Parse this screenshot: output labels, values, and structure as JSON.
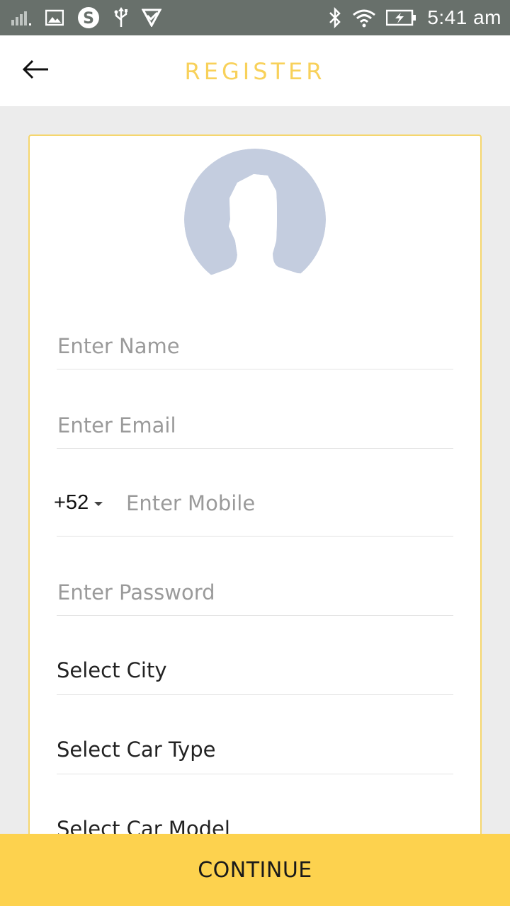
{
  "status_bar": {
    "time": "5:41 am",
    "left_icons": [
      "signal-icon",
      "image-icon",
      "skype-icon",
      "usb-icon",
      "app-check-icon"
    ],
    "right_icons": [
      "bluetooth-icon",
      "wifi-icon",
      "battery-charging-icon"
    ]
  },
  "header": {
    "title": "REGISTER",
    "back_icon": "arrow-left-icon",
    "accent_color": "#f8d15a"
  },
  "form": {
    "avatar_icon": "profile-placeholder-icon",
    "name_placeholder": "Enter Name",
    "email_placeholder": "Enter Email",
    "country_code": "+52",
    "mobile_placeholder": "Enter Mobile",
    "password_placeholder": "Enter Password",
    "city_label": "Select City",
    "car_type_label": "Select Car Type",
    "car_model_label": "Select Car Model"
  },
  "footer": {
    "continue_label": "CONTINUE",
    "button_color": "#fdd24e"
  }
}
